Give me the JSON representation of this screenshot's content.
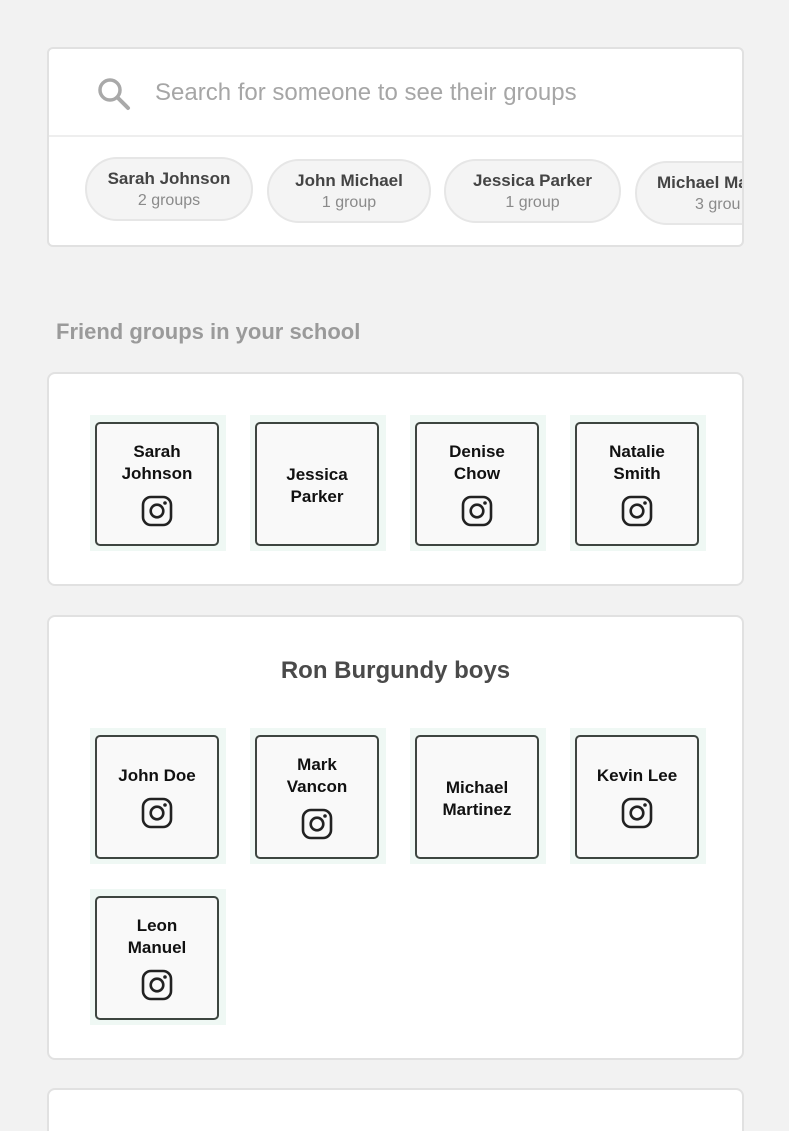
{
  "search": {
    "placeholder": "Search for someone to see their groups",
    "value": ""
  },
  "suggestions": [
    {
      "name": "Sarah Johnson",
      "count": "2 groups"
    },
    {
      "name": "John Michael",
      "count": "1 group"
    },
    {
      "name": "Jessica Parker",
      "count": "1 group"
    },
    {
      "name": "Michael Ma",
      "count": "3 grou"
    }
  ],
  "section_title": "Friend groups in your school",
  "groups": [
    {
      "title": "",
      "members": [
        {
          "name": "Sarah\nJohnson",
          "instagram": true
        },
        {
          "name": "Jessica\nParker",
          "instagram": false
        },
        {
          "name": "Denise\nChow",
          "instagram": true
        },
        {
          "name": "Natalie\nSmith",
          "instagram": true
        }
      ]
    },
    {
      "title": "Ron Burgundy boys",
      "members": [
        {
          "name": "John Doe",
          "instagram": true
        },
        {
          "name": "Mark\nVancon",
          "instagram": true
        },
        {
          "name": "Michael\nMartinez",
          "instagram": false
        },
        {
          "name": "Kevin Lee",
          "instagram": true
        },
        {
          "name": "Leon\nManuel",
          "instagram": true
        }
      ]
    }
  ],
  "colors": {
    "background": "#f2f2f2",
    "card": "#ffffff",
    "tile_border": "#3d4540",
    "tile_highlight": "#eff8f4",
    "muted_text": "#9a9a9a"
  },
  "icons": {
    "search": "search-icon",
    "instagram": "instagram-icon"
  }
}
